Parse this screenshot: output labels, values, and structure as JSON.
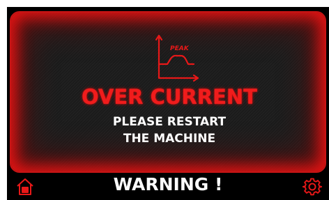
{
  "alert": {
    "title": "OVER CURRENT",
    "message_line1": "PLEASE RESTART",
    "message_line2": "THE MACHINE",
    "chart_label": "PEAK"
  },
  "footer": {
    "warning_label": "WARNING !",
    "home_icon": "home-icon",
    "settings_icon": "gear-icon"
  },
  "colors": {
    "accent": "#e81818",
    "panel_background": "#1b1b1b",
    "screen_background": "#000000",
    "text": "#ffffff"
  }
}
